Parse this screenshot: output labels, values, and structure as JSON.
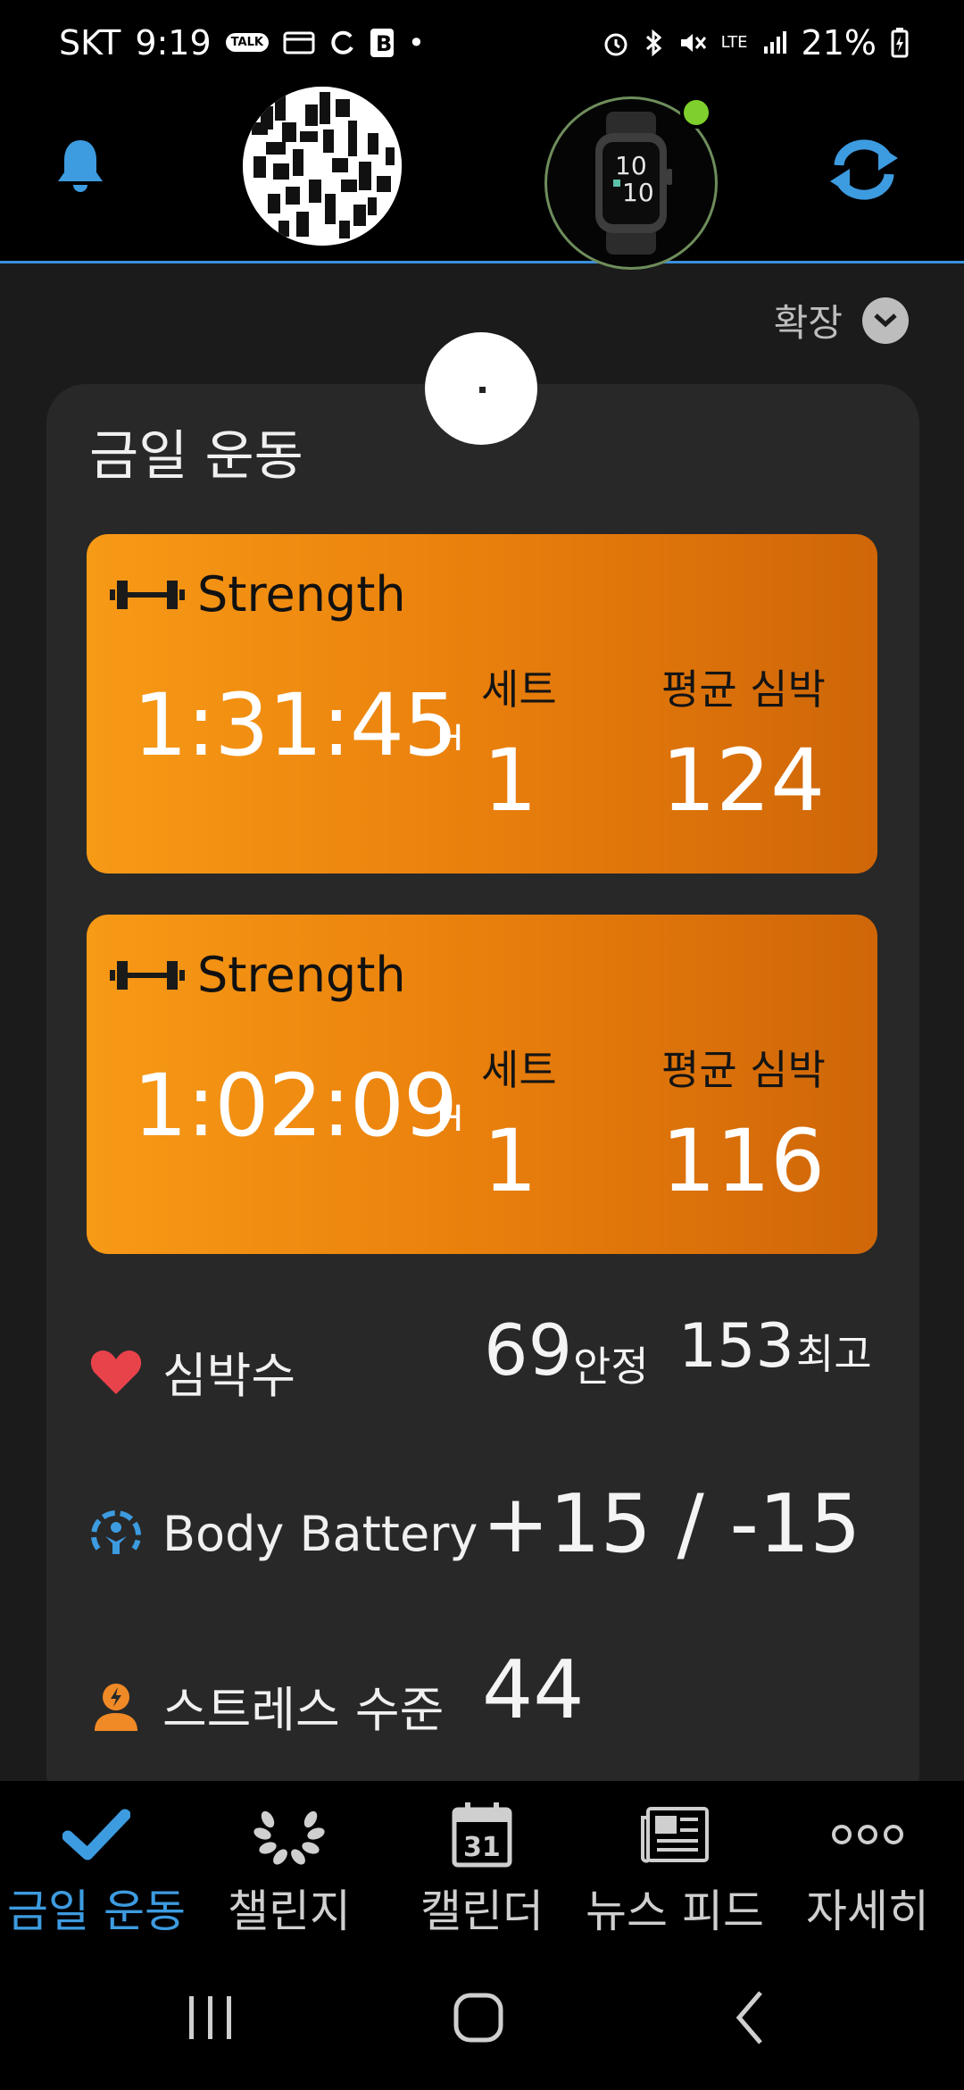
{
  "status_bar": {
    "carrier": "SKT",
    "time": "9:19",
    "talk_badge": "TALK",
    "network": "LTE",
    "battery": "21%"
  },
  "header": {
    "watch_time_top": "10",
    "watch_time_bottom": "10"
  },
  "expand": {
    "label": "확장"
  },
  "today": {
    "title": "금일 운동",
    "activities": [
      {
        "name": "Strength",
        "duration": "1:31:45",
        "unit": "H",
        "sets_label": "세트",
        "sets": "1",
        "hr_label": "평균 심박",
        "avg_hr": "124"
      },
      {
        "name": "Strength",
        "duration": "1:02:09",
        "unit": "H",
        "sets_label": "세트",
        "sets": "1",
        "hr_label": "평균 심박",
        "avg_hr": "116"
      }
    ],
    "heart_rate": {
      "label": "심박수",
      "resting": "69",
      "resting_label": "안정",
      "max": "153",
      "max_label": "최고"
    },
    "body_battery": {
      "label": "Body Battery",
      "value": "+15 / -15"
    },
    "stress": {
      "label": "스트레스 수준",
      "value": "44"
    }
  },
  "nav": {
    "items": [
      {
        "label": "금일 운동",
        "icon": "check-icon"
      },
      {
        "label": "챌린지",
        "icon": "laurel-icon"
      },
      {
        "label": "캘린더",
        "icon": "calendar-icon",
        "calendar_day": "31"
      },
      {
        "label": "뉴스 피드",
        "icon": "newsfeed-icon"
      },
      {
        "label": "자세히",
        "icon": "more-icon"
      }
    ]
  },
  "colors": {
    "accent_blue": "#3d9be0",
    "activity_orange": "#f0880f",
    "heart_red": "#e8424b",
    "stress_orange": "#f08a26",
    "watch_dot_green": "#7fd02c"
  }
}
